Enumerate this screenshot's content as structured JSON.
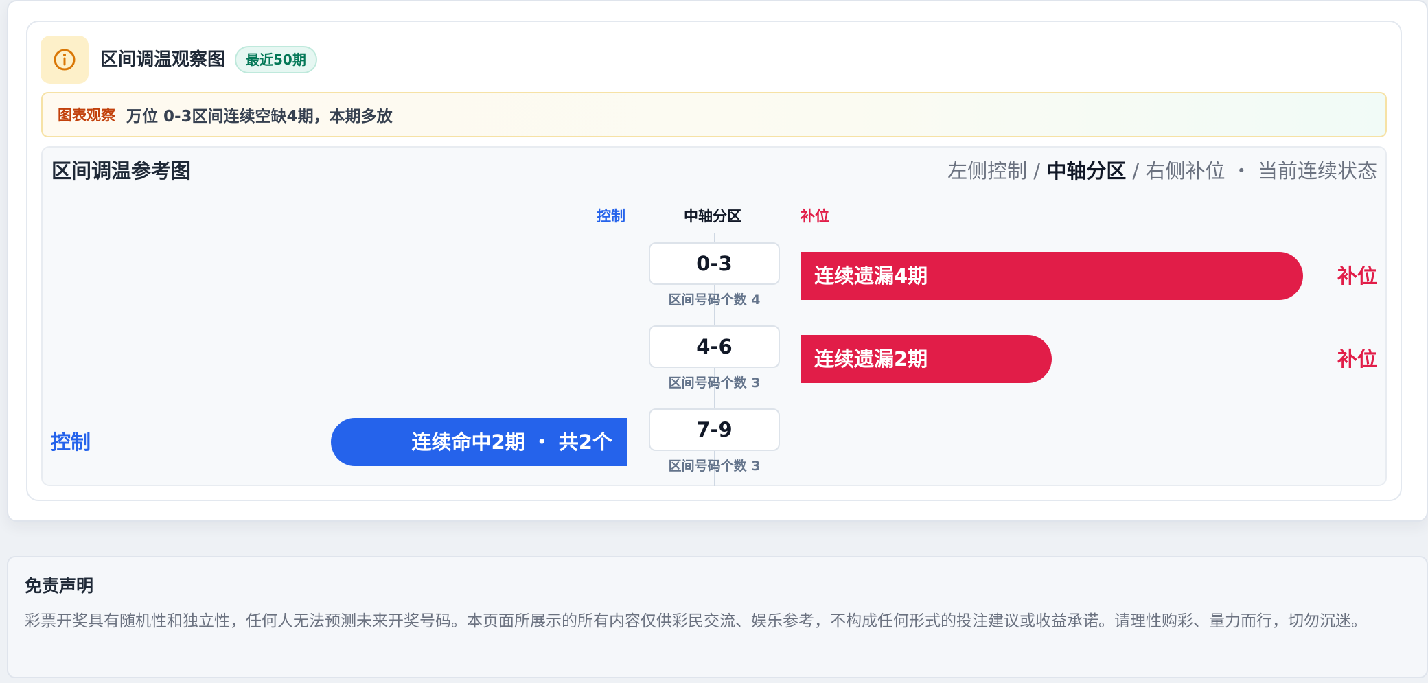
{
  "header": {
    "title": "区间调温观察图",
    "badge": "最近50期",
    "icon": "info-icon"
  },
  "notice": {
    "tag": "图表观察",
    "text": "万位 0-3区间连续空缺4期，本期多放"
  },
  "chart": {
    "title": "区间调温参考图",
    "legend": {
      "left": "左侧控制 / ",
      "center": "中轴分区",
      "right": " / 右侧补位 ・ 当前连续状态"
    },
    "columns": {
      "control": "控制",
      "axis": "中轴分区",
      "fill": "补位"
    },
    "colors": {
      "control": "#2563eb",
      "fill": "#e11d48"
    }
  },
  "chart_data": {
    "type": "bar",
    "categories": [
      "0-3",
      "4-6",
      "7-9"
    ],
    "rows": [
      {
        "range": "0-3",
        "count_label": "区间号码个数 4",
        "side": "fill",
        "streak": 4,
        "bar_label": "连续遗漏4期",
        "side_label": "补位"
      },
      {
        "range": "4-6",
        "count_label": "区间号码个数 3",
        "side": "fill",
        "streak": 2,
        "bar_label": "连续遗漏2期",
        "side_label": "补位"
      },
      {
        "range": "7-9",
        "count_label": "区间号码个数 3",
        "side": "control",
        "streak": 2,
        "bar_label": "连续命中2期 ・ 共2个",
        "side_label": "控制"
      }
    ]
  },
  "disclaimer": {
    "title": "免责声明",
    "text": "彩票开奖具有随机性和独立性，任何人无法预测未来开奖号码。本页面所展示的所有内容仅供彩民交流、娱乐参考，不构成任何形式的投注建议或收益承诺。请理性购彩、量力而行，切勿沉迷。"
  }
}
